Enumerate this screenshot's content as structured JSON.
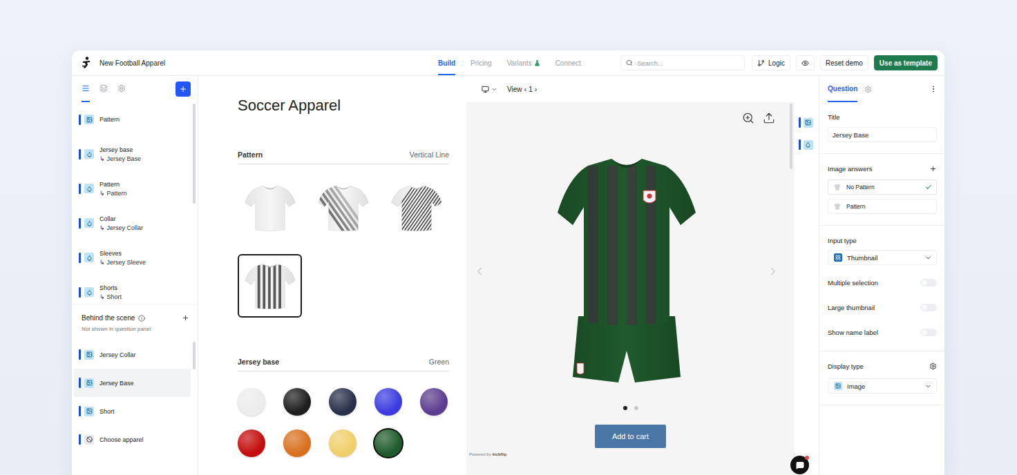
{
  "app": {
    "title": "New Football Apparel"
  },
  "nav_tabs": [
    {
      "label": "Build",
      "selected": true,
      "badge": false
    },
    {
      "label": "Pricing",
      "selected": false,
      "badge": false
    },
    {
      "label": "Variants",
      "selected": false,
      "badge": true
    },
    {
      "label": "Connect",
      "selected": false,
      "badge": false
    }
  ],
  "search": {
    "placeholder": "Search..."
  },
  "toolbar_buttons": {
    "logic": "Logic",
    "reset": "Reset demo",
    "template": "Use as template"
  },
  "sidebar": {
    "tabs": [
      {
        "kind": "list",
        "selected": true
      },
      {
        "kind": "layers",
        "selected": false
      },
      {
        "kind": "settings",
        "selected": false
      }
    ],
    "link_icon": "↳",
    "items": [
      {
        "kind": "image",
        "name": "Pattern",
        "sub": "",
        "selected": false
      },
      {
        "kind": "color",
        "name": "Jersey base",
        "sub": "Jersey Base",
        "selected": false
      },
      {
        "kind": "color",
        "name": "Pattern",
        "sub": "Pattern",
        "selected": false
      },
      {
        "kind": "color",
        "name": "Collar",
        "sub": "Jersey Collar",
        "selected": false
      },
      {
        "kind": "color",
        "name": "Sleeves",
        "sub": "Jersey Sleeve",
        "selected": false
      },
      {
        "kind": "color",
        "name": "Shorts",
        "sub": "Short",
        "selected": false
      }
    ],
    "behind": {
      "title": "Behind the scene",
      "hint": "Not shown in question panel",
      "items": [
        {
          "kind": "image",
          "name": "Jersey Collar",
          "selected": false
        },
        {
          "kind": "image",
          "name": "Jersey Base",
          "selected": true
        },
        {
          "kind": "image",
          "name": "Short",
          "selected": false
        },
        {
          "kind": "none",
          "name": "Choose apparel",
          "selected": false
        }
      ]
    }
  },
  "questions": {
    "title": "Soccer Apparel",
    "pattern": {
      "label": "Pattern",
      "value": "Vertical Line",
      "options": [
        {
          "kind": "plain",
          "selected": false
        },
        {
          "kind": "diagonal-band",
          "selected": false
        },
        {
          "kind": "diagonal-lines",
          "selected": false
        },
        {
          "kind": "vertical-lines",
          "selected": true
        }
      ]
    },
    "jersey_base": {
      "label": "Jersey base",
      "value": "Green",
      "options": [
        {
          "color": "#ececec",
          "selected": false
        },
        {
          "color": "#1d1d1d",
          "selected": false
        },
        {
          "color": "#283049",
          "selected": false
        },
        {
          "color": "#3b3be0",
          "selected": false
        },
        {
          "color": "#5b3d8f",
          "selected": false
        },
        {
          "color": "#c40d0d",
          "selected": false
        },
        {
          "color": "#d9701e",
          "selected": false
        },
        {
          "color": "#f0cf6a",
          "selected": false
        },
        {
          "color": "#1f5a2c",
          "selected": true
        }
      ]
    }
  },
  "preview": {
    "view_label": "View",
    "view_prev": "‹",
    "view_index": "1",
    "view_next": "›",
    "slides": [
      {
        "selected": true
      },
      {
        "selected": false
      }
    ],
    "add_to_cart": "Add to cart",
    "powered_by": "Powered by",
    "brand": "kickflip"
  },
  "rail": [
    {
      "kind": "image"
    },
    {
      "kind": "color"
    }
  ],
  "inspector": {
    "tab": "Question",
    "title_label": "Title",
    "title_value": "Jersey Base",
    "answers_label": "Image answers",
    "answers": [
      {
        "name": "No Pattern",
        "selected": true
      },
      {
        "name": "Pattern",
        "selected": false
      }
    ],
    "input_type_label": "Input type",
    "input_type": "Thumbnail",
    "toggles": [
      {
        "label": "Multiple selection",
        "on": false
      },
      {
        "label": "Large thumbnail",
        "on": false
      },
      {
        "label": "Show name label",
        "on": false
      }
    ],
    "display_type_label": "Display type",
    "display_type": "Image"
  },
  "chat": {
    "unread": true
  }
}
